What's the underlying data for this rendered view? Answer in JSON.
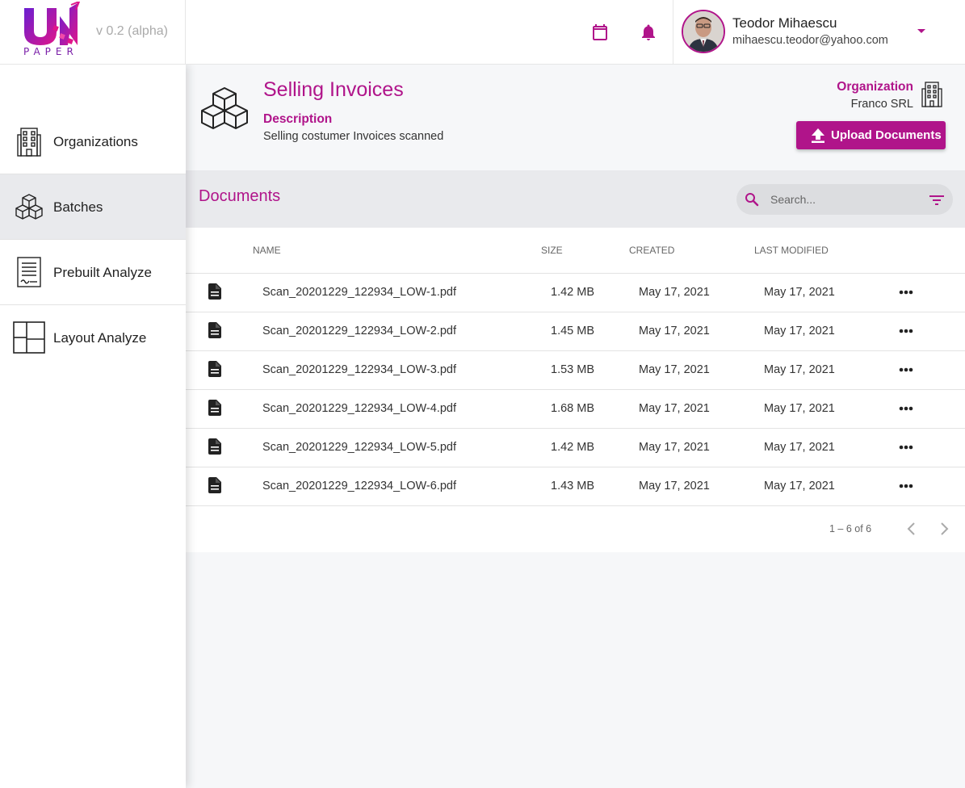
{
  "app": {
    "logo_text": "PAPER",
    "version": "v 0.2 (alpha)"
  },
  "topbar": {
    "icons": [
      "calendar-icon",
      "bell-icon"
    ],
    "user": {
      "name": "Teodor Mihaescu",
      "email": "mihaescu.teodor@yahoo.com"
    }
  },
  "sidebar": {
    "items": [
      {
        "label": "Organizations",
        "icon": "building-icon",
        "active": false
      },
      {
        "label": "Batches",
        "icon": "boxes-icon",
        "active": true
      },
      {
        "label": "Prebuilt Analyze",
        "icon": "document-signature-icon",
        "active": false
      },
      {
        "label": "Layout Analyze",
        "icon": "layout-icon",
        "active": false
      }
    ]
  },
  "batch": {
    "title": "Selling Invoices",
    "description_label": "Description",
    "description": "Selling costumer Invoices scanned",
    "organization_label": "Organization",
    "organization": "Franco SRL",
    "upload_label": "Upload Documents"
  },
  "documents": {
    "title": "Documents",
    "search_placeholder": "Search...",
    "columns": {
      "name": "Name",
      "size": "Size",
      "created": "Created",
      "modified": "Last Modified"
    },
    "rows": [
      {
        "name": "Scan_20201229_122934_LOW-1.pdf",
        "size": "1.42 MB",
        "created": "May 17, 2021",
        "modified": "May 17, 2021"
      },
      {
        "name": "Scan_20201229_122934_LOW-2.pdf",
        "size": "1.45 MB",
        "created": "May 17, 2021",
        "modified": "May 17, 2021"
      },
      {
        "name": "Scan_20201229_122934_LOW-3.pdf",
        "size": "1.53 MB",
        "created": "May 17, 2021",
        "modified": "May 17, 2021"
      },
      {
        "name": "Scan_20201229_122934_LOW-4.pdf",
        "size": "1.68 MB",
        "created": "May 17, 2021",
        "modified": "May 17, 2021"
      },
      {
        "name": "Scan_20201229_122934_LOW-5.pdf",
        "size": "1.42 MB",
        "created": "May 17, 2021",
        "modified": "May 17, 2021"
      },
      {
        "name": "Scan_20201229_122934_LOW-6.pdf",
        "size": "1.43 MB",
        "created": "May 17, 2021",
        "modified": "May 17, 2021"
      }
    ],
    "pagination": "1 – 6 of 6"
  },
  "colors": {
    "accent": "#b0148a",
    "active_nav": "#e9eaed"
  }
}
